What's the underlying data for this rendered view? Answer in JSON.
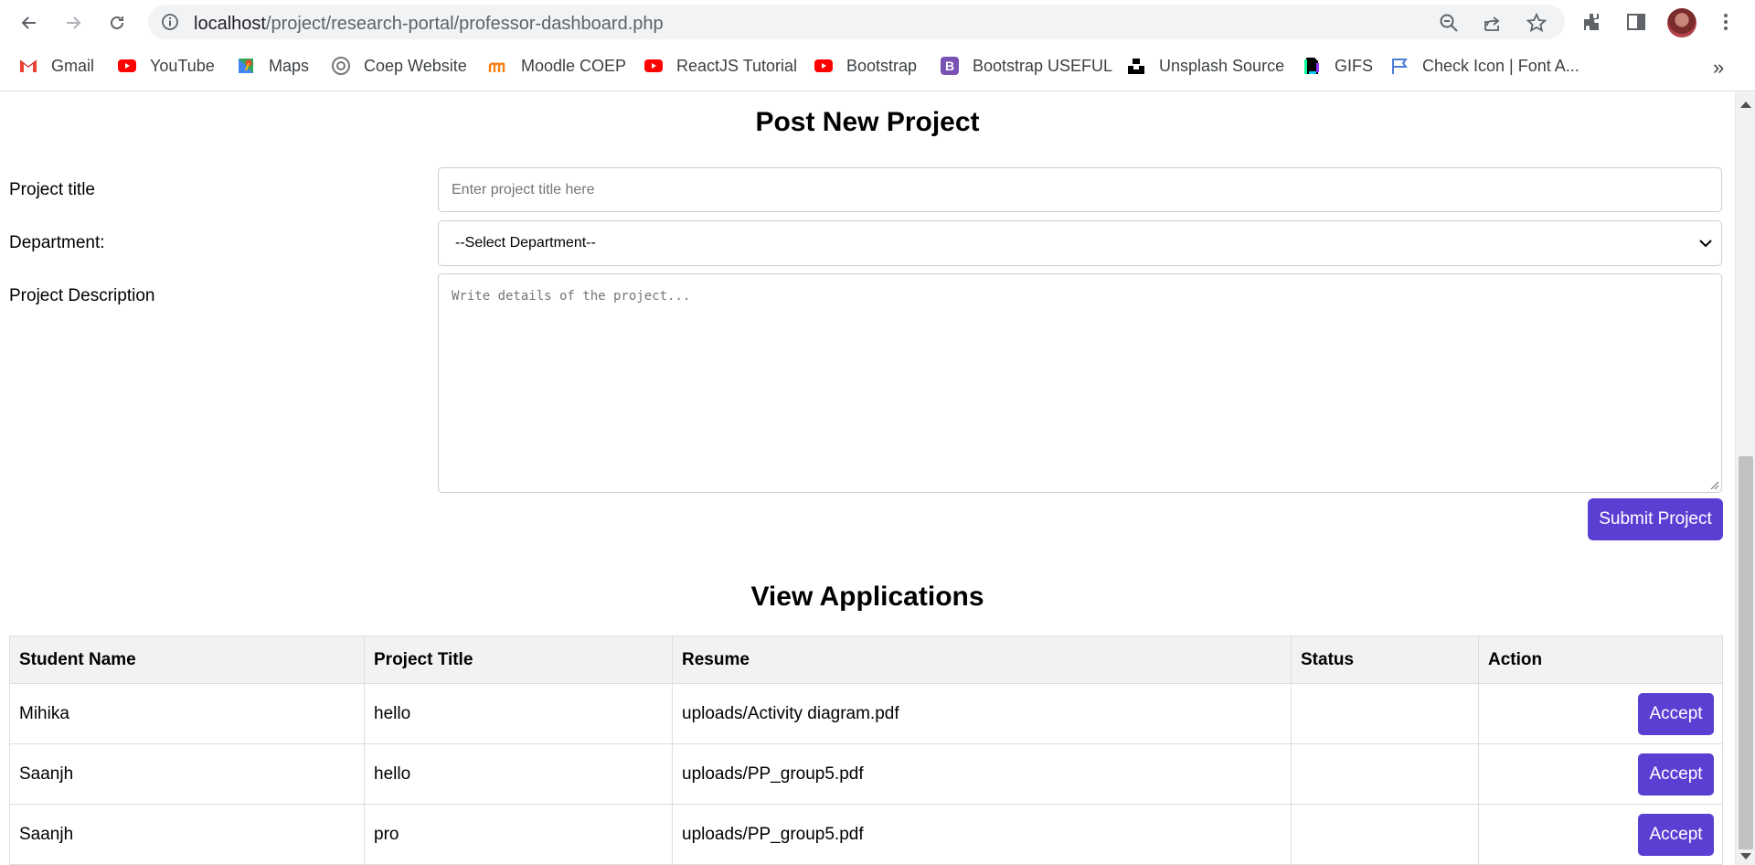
{
  "browser": {
    "url_host": "localhost",
    "url_path": "/project/research-portal/professor-dashboard.php",
    "bookmarks": [
      {
        "label": "Gmail",
        "icon": "gmail-icon"
      },
      {
        "label": "YouTube",
        "icon": "youtube-icon"
      },
      {
        "label": "Maps",
        "icon": "maps-icon"
      },
      {
        "label": "Coep Website",
        "icon": "coep-icon"
      },
      {
        "label": "Moodle COEP",
        "icon": "moodle-icon"
      },
      {
        "label": "ReactJS Tutorial",
        "icon": "youtube-icon"
      },
      {
        "label": "Bootstrap",
        "icon": "youtube-icon"
      },
      {
        "label": "Bootstrap USEFUL",
        "icon": "bootstrap-icon"
      },
      {
        "label": "Unsplash Source",
        "icon": "unsplash-icon"
      },
      {
        "label": "GIFS",
        "icon": "gifs-icon"
      },
      {
        "label": "Check Icon | Font A...",
        "icon": "flag-icon"
      }
    ],
    "more": "»"
  },
  "form": {
    "title": "Post New Project",
    "project_title_label": "Project title",
    "project_title_placeholder": "Enter project title here",
    "department_label": "Department:",
    "department_selected": "--Select Department--",
    "description_label": "Project Description",
    "description_placeholder": "Write details of the project...",
    "submit_label": "Submit Project"
  },
  "applications": {
    "title": "View Applications",
    "columns": [
      "Student Name",
      "Project Title",
      "Resume",
      "Status",
      "Action"
    ],
    "rows": [
      {
        "student": "Mihika",
        "project": "hello",
        "resume": "uploads/Activity diagram.pdf",
        "status": "",
        "action": "Accept"
      },
      {
        "student": "Saanjh",
        "project": "hello",
        "resume": "uploads/PP_group5.pdf",
        "status": "",
        "action": "Accept"
      },
      {
        "student": "Saanjh",
        "project": "pro",
        "resume": "uploads/PP_group5.pdf",
        "status": "",
        "action": "Accept"
      }
    ]
  },
  "colors": {
    "accent": "#5b3fd3",
    "table_header_bg": "#f2f2f2"
  }
}
